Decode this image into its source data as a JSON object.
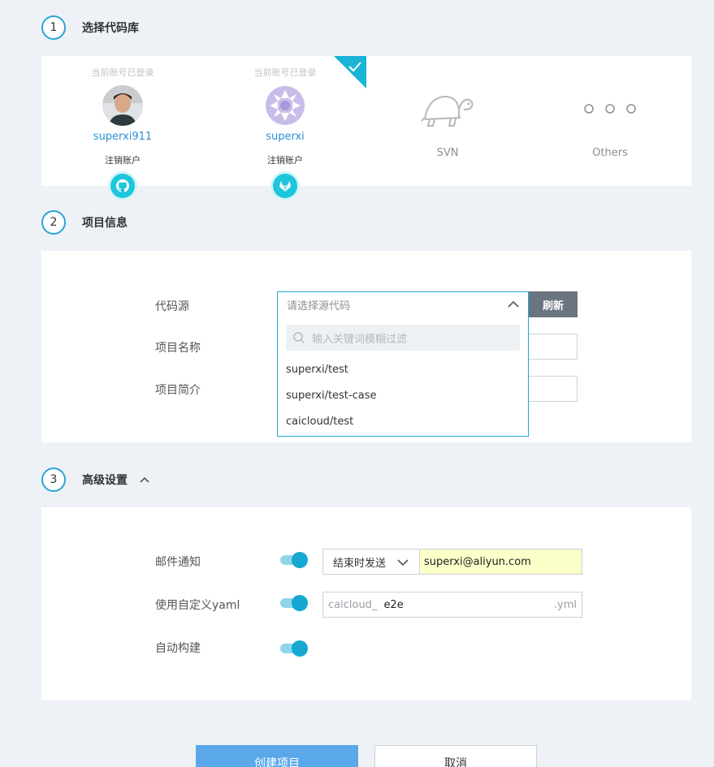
{
  "steps": [
    {
      "num": "1",
      "title": "选择代码库"
    },
    {
      "num": "2",
      "title": "项目信息"
    },
    {
      "num": "3",
      "title": "高级设置"
    }
  ],
  "repos": {
    "github": {
      "logged": "当前账号已登录",
      "username": "superxi911",
      "logout": "注销账户",
      "icon": "github-icon"
    },
    "gitlab": {
      "logged": "当前账号已登录",
      "username": "superxi",
      "logout": "注销账户",
      "icon": "gitlab-icon",
      "selected": true
    },
    "svn": {
      "name": "SVN",
      "icon": "turtle-icon"
    },
    "others": {
      "name": "Others",
      "icon": "ellipsis-icon"
    }
  },
  "project_info": {
    "source_label": "代码源",
    "source_placeholder": "请选择源代码",
    "refresh_label": "刷新",
    "name_label": "项目名称",
    "desc_label": "项目简介",
    "search_placeholder": "输入关键词模糊过滤",
    "options": [
      "superxi/test",
      "superxi/test-case",
      "caicloud/test"
    ]
  },
  "advanced": {
    "email_label": "邮件通知",
    "email_when": "结束时发送",
    "email_value": "superxi@aliyun.com",
    "yaml_label": "使用自定义yaml",
    "yaml_prefix": "caicloud_",
    "yaml_value": "e2e",
    "yaml_suffix": ".yml",
    "auto_label": "自动构建"
  },
  "actions": {
    "create": "创建项目",
    "cancel": "取消"
  },
  "colors": {
    "accent": "#2aa3d6",
    "toggle": "#17a8d2",
    "primary_button": "#5aa8ea",
    "badge": "#1ec6dc"
  }
}
